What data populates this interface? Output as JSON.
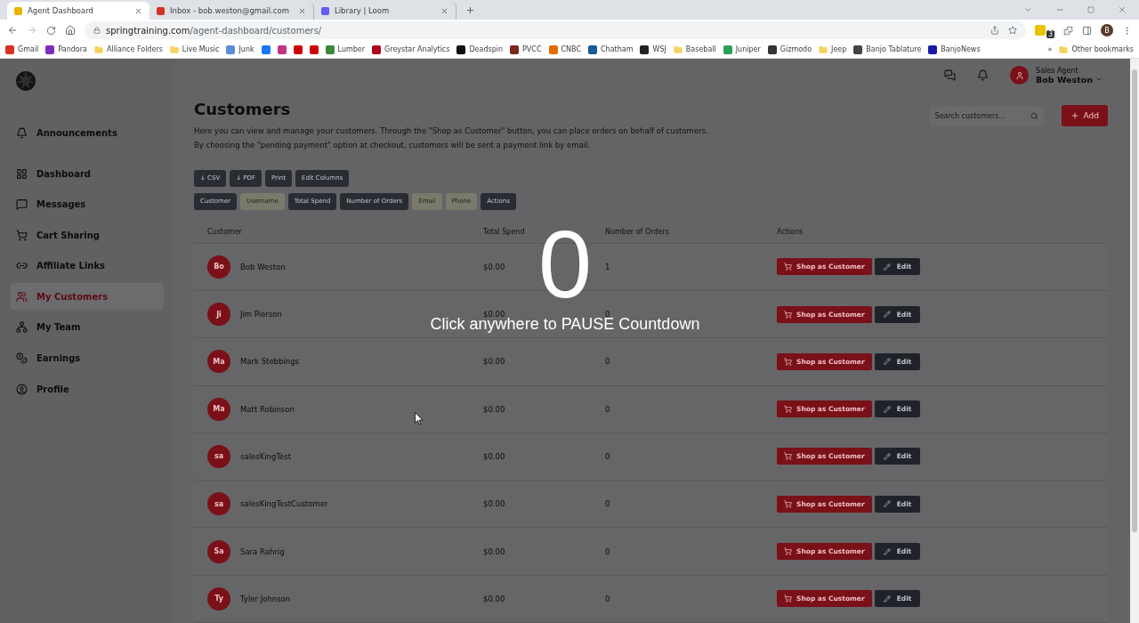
{
  "browser": {
    "tabs": [
      {
        "title": "Agent Dashboard",
        "selected": true,
        "color": "#e8b400"
      },
      {
        "title": "Inbox - bob.weston@gmail.com",
        "selected": false,
        "color": "#d93025"
      },
      {
        "title": "Library | Loom",
        "selected": false,
        "color": "#625df5"
      }
    ],
    "url_host": "springtraining.com",
    "url_path": "/agent-dashboard/customers/",
    "profile_initial": "B",
    "extension_badge": "3",
    "bookmarks": [
      {
        "label": "Gmail",
        "kind": "site",
        "color": "#d93025"
      },
      {
        "label": "Pandora",
        "kind": "site",
        "color": "#7b2cbf"
      },
      {
        "label": "Alliance Folders",
        "kind": "folder",
        "color": "#f4d35e"
      },
      {
        "label": "Live Music",
        "kind": "folder",
        "color": "#f4d35e"
      },
      {
        "label": "Junk",
        "kind": "site",
        "color": "#5b8dd9"
      },
      {
        "kind": "site",
        "color": "#1877f2"
      },
      {
        "kind": "site",
        "color": "#c13584"
      },
      {
        "kind": "site",
        "color": "#cc0000"
      },
      {
        "kind": "site",
        "color": "#cc0000"
      },
      {
        "label": "Lumber",
        "kind": "site",
        "color": "#3a8a3a"
      },
      {
        "label": "Greystar Analytics",
        "kind": "site",
        "color": "#b00020"
      },
      {
        "label": "Deadspin",
        "kind": "site",
        "color": "#111111"
      },
      {
        "label": "PVCC",
        "kind": "site",
        "color": "#7a2a1a"
      },
      {
        "label": "CNBC",
        "kind": "site",
        "color": "#e66a00"
      },
      {
        "label": "Chatham",
        "kind": "site",
        "color": "#1a5c9a"
      },
      {
        "label": "WSJ",
        "kind": "site",
        "color": "#222222"
      },
      {
        "label": "Baseball",
        "kind": "folder",
        "color": "#f4d35e"
      },
      {
        "label": "Juniper",
        "kind": "site",
        "color": "#2e9e5b"
      },
      {
        "label": "Gizmodo",
        "kind": "site",
        "color": "#333333"
      },
      {
        "label": "Jeep",
        "kind": "folder",
        "color": "#f4d35e"
      },
      {
        "label": "Banjo Tablature",
        "kind": "site",
        "color": "#444444"
      },
      {
        "label": "BanjoNews",
        "kind": "site",
        "color": "#1a1aa6"
      }
    ],
    "more": "»",
    "other_bookmarks": "Other bookmarks"
  },
  "header": {
    "role": "Sales Agent",
    "user": "Bob Weston"
  },
  "sidebar": {
    "items": [
      {
        "label": "Announcements",
        "selected": false
      },
      {
        "label": "Dashboard",
        "selected": false
      },
      {
        "label": "Messages",
        "selected": false
      },
      {
        "label": "Cart Sharing",
        "selected": false
      },
      {
        "label": "Affiliate Links",
        "selected": false
      },
      {
        "label": "My Customers",
        "selected": true
      },
      {
        "label": "My Team",
        "selected": false
      },
      {
        "label": "Earnings",
        "selected": false
      },
      {
        "label": "Profile",
        "selected": false
      }
    ]
  },
  "page": {
    "title": "Customers",
    "description": "Here you can view and manage your customers. Through the \"Shop as Customer\" button, you can place orders on behalf of customers. By choosing the \"pending payment\" option at checkout, customers will be sent a payment link by email.",
    "search_placeholder": "Search customers...",
    "add": "Add",
    "export_buttons": [
      "↓ CSV",
      "↓ PDF",
      "Print",
      "Edit Columns"
    ],
    "column_toggles": [
      {
        "label": "Customer",
        "selected": true
      },
      {
        "label": "Username",
        "selected": false
      },
      {
        "label": "Total Spend",
        "selected": true
      },
      {
        "label": "Number of Orders",
        "selected": true
      },
      {
        "label": "Email",
        "selected": false
      },
      {
        "label": "Phone",
        "selected": false
      },
      {
        "label": "Actions",
        "selected": true
      }
    ]
  },
  "table": {
    "columns": [
      "Customer",
      "Total Spend",
      "Number of Orders",
      "Actions"
    ],
    "rows": [
      {
        "initials": "Bo",
        "name": "Bob Weston",
        "spend": "$0.00",
        "orders": "1",
        "shop": "Shop as Customer",
        "edit": "Edit"
      },
      {
        "initials": "Ji",
        "name": "Jim Pierson",
        "spend": "$0.00",
        "orders": "0",
        "shop": "Shop as Customer",
        "edit": "Edit"
      },
      {
        "initials": "Ma",
        "name": "Mark Stebbings",
        "spend": "$0.00",
        "orders": "0",
        "shop": "Shop as Customer",
        "edit": "Edit"
      },
      {
        "initials": "Ma",
        "name": "Matt Robinson",
        "spend": "$0.00",
        "orders": "0",
        "shop": "Shop as Customer",
        "edit": "Edit"
      },
      {
        "initials": "sa",
        "name": "salesKingTest",
        "spend": "$0.00",
        "orders": "0",
        "shop": "Shop as Customer",
        "edit": "Edit"
      },
      {
        "initials": "sa",
        "name": "salesKingTestCustomer",
        "spend": "$0.00",
        "orders": "0",
        "shop": "Shop as Customer",
        "edit": "Edit"
      },
      {
        "initials": "Sa",
        "name": "Sara Rahrig",
        "spend": "$0.00",
        "orders": "0",
        "shop": "Shop as Customer",
        "edit": "Edit"
      },
      {
        "initials": "Ty",
        "name": "Tyler Johnson",
        "spend": "$0.00",
        "orders": "0",
        "shop": "Shop as Customer",
        "edit": "Edit"
      }
    ]
  },
  "countdown": {
    "number": "0",
    "message": "Click anywhere to PAUSE Countdown"
  }
}
